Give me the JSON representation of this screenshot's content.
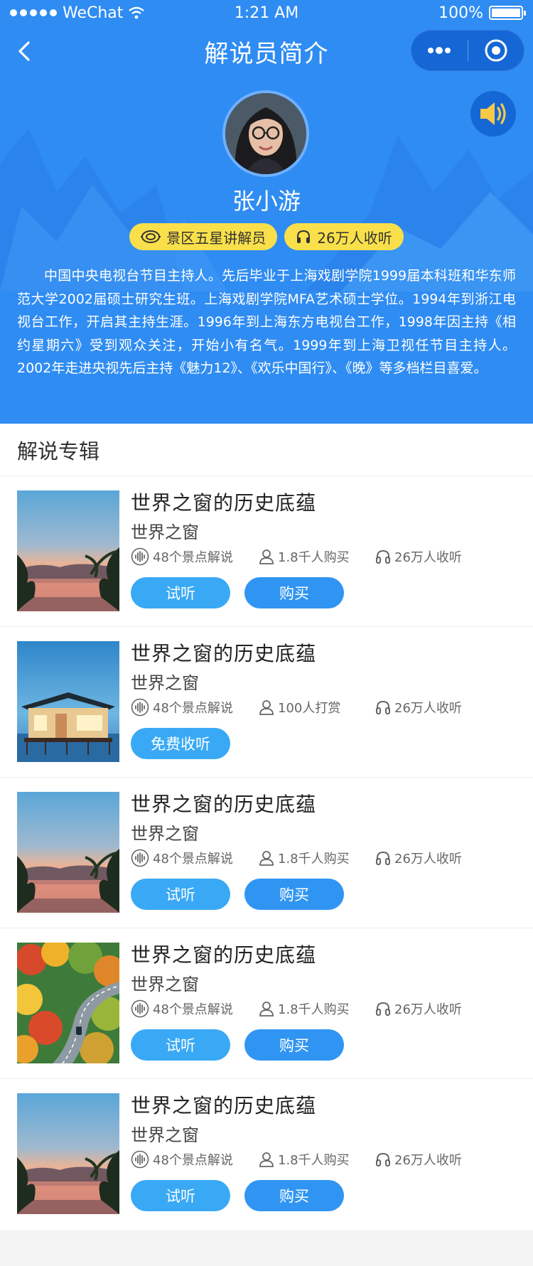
{
  "status_bar": {
    "carrier": "WeChat",
    "time": "1:21 AM",
    "battery": "100%"
  },
  "nav": {
    "title": "解说员简介"
  },
  "guide": {
    "name": "张小游",
    "badge_rank": "景区五星讲解员",
    "badge_listeners": "26万人收听",
    "bio": "中国中央电视台节目主持人。先后毕业于上海戏剧学院1999届本科班和华东师范大学2002届硕士研究生班。上海戏剧学院MFA艺术硕士学位。1994年到浙江电视台工作，开启其主持生涯。1996年到上海东方电视台工作，1998年因主持《相约星期六》受到观众关注，开始小有名气。1999年到上海卫视任节目主持人。2002年走进央视先后主持《魅力12》、《欢乐中国行》、《晚》等多档栏目喜爱。"
  },
  "section": {
    "title": "解说专辑"
  },
  "albums": [
    {
      "title": "世界之窗的历史底蕴",
      "subtitle": "世界之窗",
      "spots": "48个景点解说",
      "buyers": "1.8千人购买",
      "listeners": "26万人收听",
      "try_label": "试听",
      "buy_label": "购买",
      "thumb": "sunset-lake"
    },
    {
      "title": "世界之窗的历史底蕴",
      "subtitle": "世界之窗",
      "spots": "48个景点解说",
      "buyers": "100人打赏",
      "listeners": "26万人收听",
      "free_label": "免费收听",
      "thumb": "house-on-water"
    },
    {
      "title": "世界之窗的历史底蕴",
      "subtitle": "世界之窗",
      "spots": "48个景点解说",
      "buyers": "1.8千人购买",
      "listeners": "26万人收听",
      "try_label": "试听",
      "buy_label": "购买",
      "thumb": "sunset-lake"
    },
    {
      "title": "世界之窗的历史底蕴",
      "subtitle": "世界之窗",
      "spots": "48个景点解说",
      "buyers": "1.8千人购买",
      "listeners": "26万人收听",
      "try_label": "试听",
      "buy_label": "购买",
      "thumb": "autumn-road"
    },
    {
      "title": "世界之窗的历史底蕴",
      "subtitle": "世界之窗",
      "spots": "48个景点解说",
      "buyers": "1.8千人购买",
      "listeners": "26万人收听",
      "try_label": "试听",
      "buy_label": "购买",
      "thumb": "sunset-lake"
    }
  ],
  "colors": {
    "header_blue": "#2f8cf2",
    "badge_yellow": "#f9e04a",
    "button_light_blue": "#39a9f6",
    "button_blue": "#3095f2"
  }
}
